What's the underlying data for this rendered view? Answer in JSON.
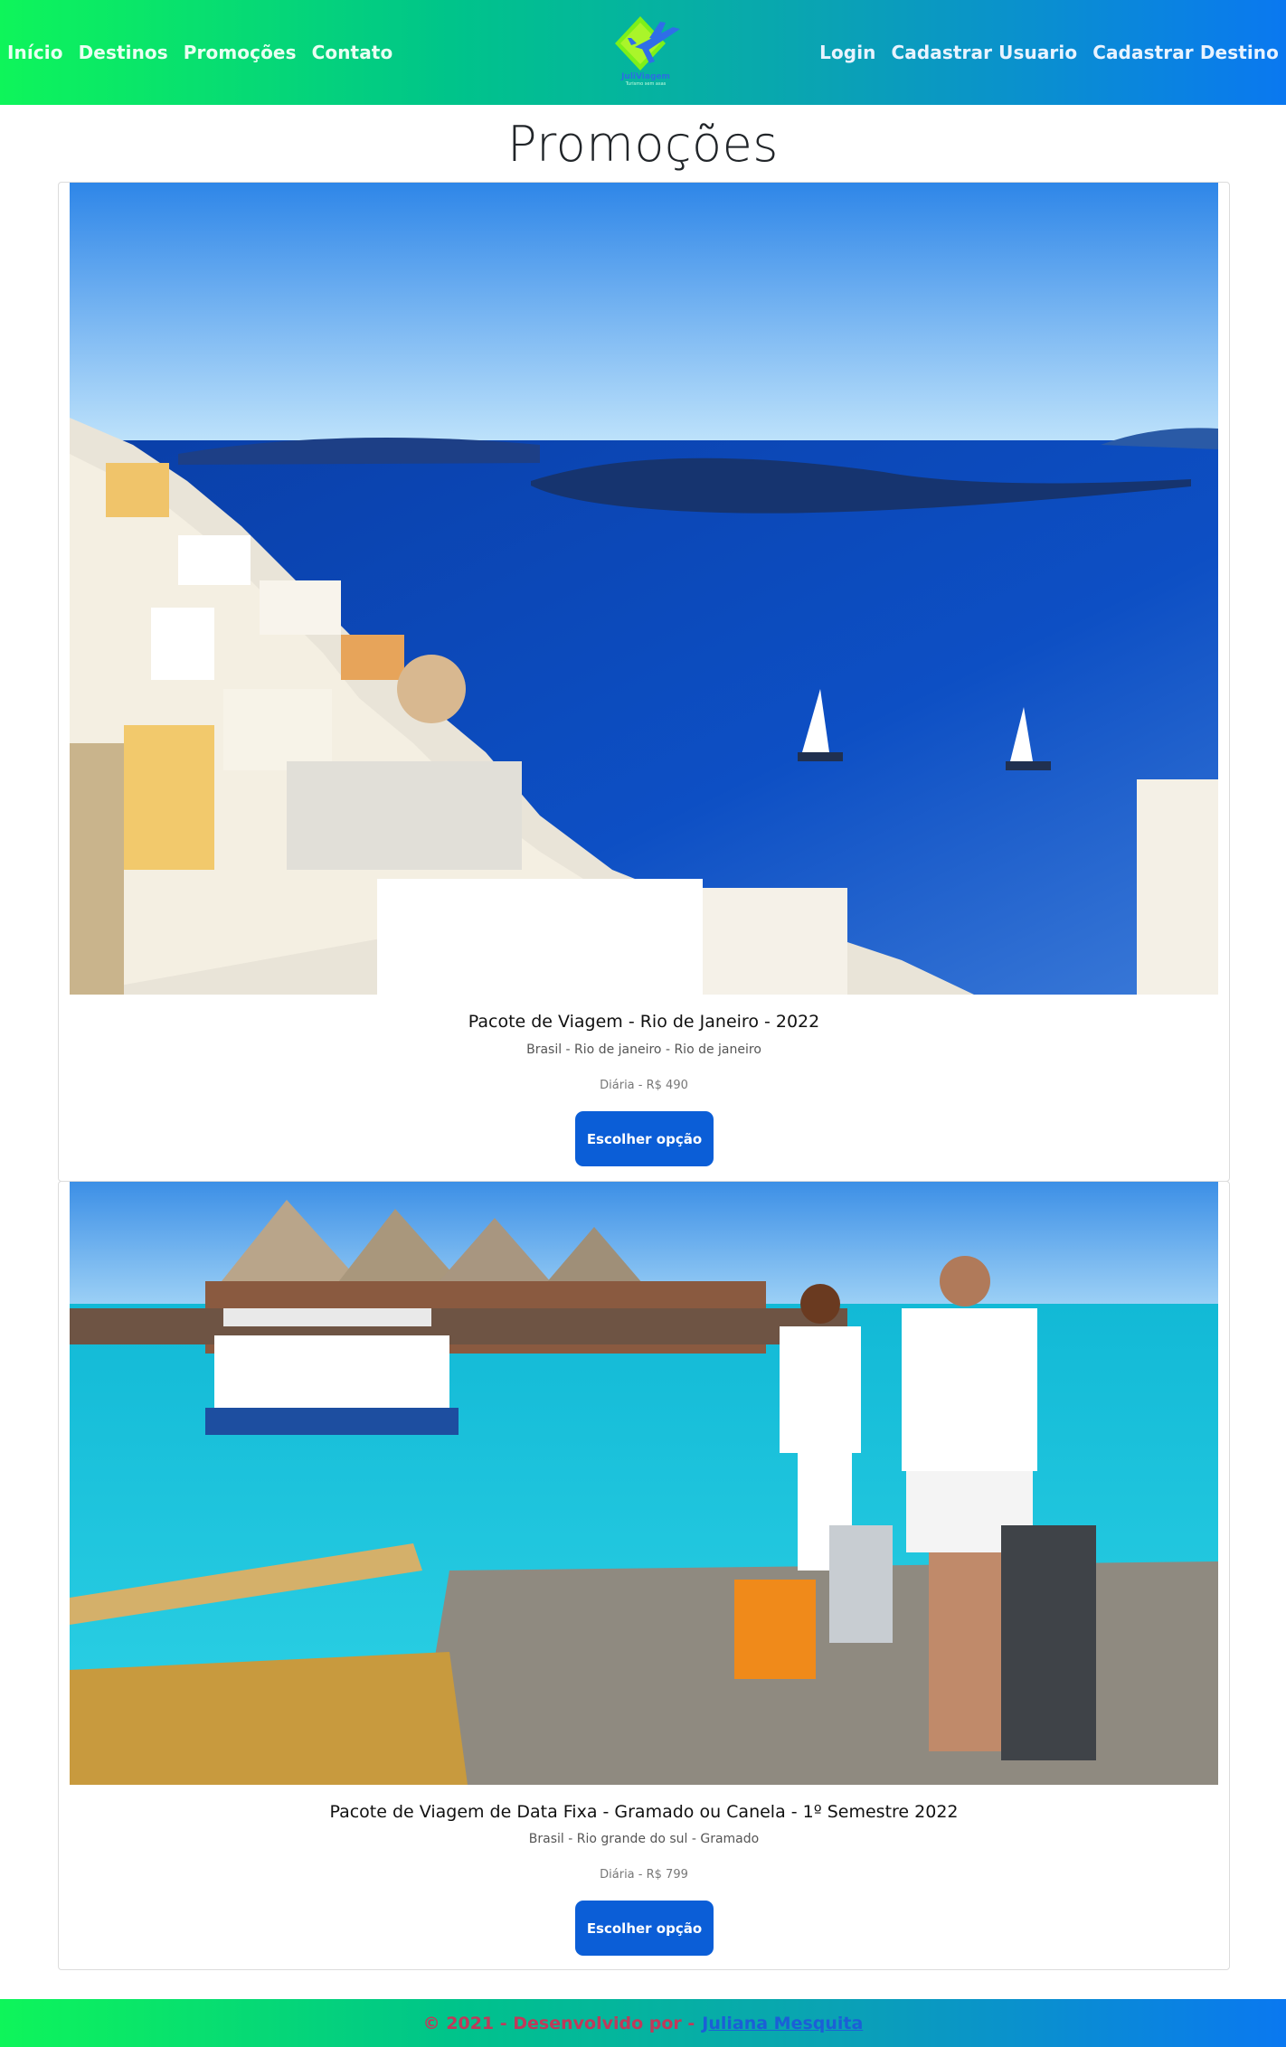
{
  "nav": {
    "left_links": [
      "Início",
      "Destinos",
      "Promoções",
      "Contato"
    ],
    "right_links": [
      "Login",
      "Cadastrar Usuario",
      "Cadastrar Destino"
    ],
    "brand": {
      "name": "JuliViagem",
      "tagline": "Turismo sem asas",
      "icon": "plane-logo-icon"
    }
  },
  "page": {
    "title": "Promoções"
  },
  "cards": [
    {
      "title": "Pacote de Viagem - Rio de Janeiro - 2022",
      "location": "Brasil - Rio de janeiro - Rio de janeiro",
      "price": "Diária - R$ 490",
      "button": "Escolher opção",
      "image": "santorini-coast-photo"
    },
    {
      "title": "Pacote de Viagem de Data Fixa - Gramado ou Canela - 1º Semestre 2022",
      "location": "Brasil - Rio grande do sul - Gramado",
      "price": "Diária - R$ 799",
      "button": "Escolher opção",
      "image": "beach-pier-couple-photo"
    }
  ],
  "footer": {
    "text": "© 2021 - Desenvolvido por -",
    "author_link": "Juliana Mesquita"
  },
  "colors": {
    "accent": "#0b5ed7",
    "nav_gradient_start": "#0ef55a",
    "nav_gradient_end": "#0a78f0",
    "footer_text": "#c0395a"
  }
}
